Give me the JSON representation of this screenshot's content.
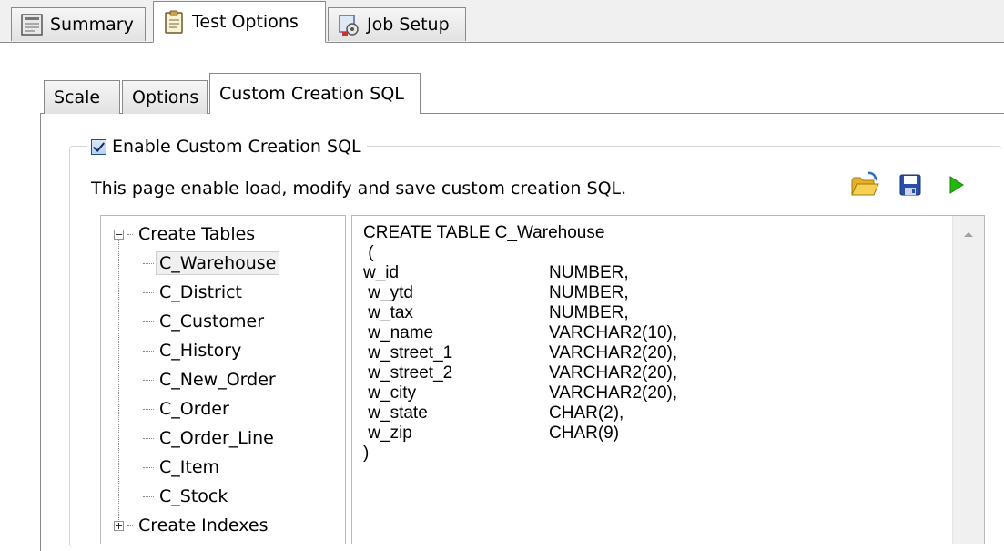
{
  "top_tabs": {
    "summary": "Summary",
    "test_options": "Test Options",
    "job_setup": "Job Setup"
  },
  "inner_tabs": {
    "scale": "Scale",
    "options": "Options",
    "custom_sql": "Custom Creation SQL"
  },
  "custom_sql": {
    "enable_label": "Enable Custom Creation SQL",
    "enabled": true,
    "description": "This page enable load, modify and save custom creation SQL.",
    "toolbar_icons": [
      "open-folder-icon",
      "save-icon",
      "run-icon"
    ]
  },
  "tree": {
    "create_tables": "Create Tables",
    "tables": [
      "C_Warehouse",
      "C_District",
      "C_Customer",
      "C_History",
      "C_New_Order",
      "C_Order",
      "C_Order_Line",
      "C_Item",
      "C_Stock"
    ],
    "selected": "C_Warehouse",
    "create_indexes": "Create Indexes"
  },
  "sql": {
    "header": "CREATE TABLE C_Warehouse",
    "open_paren": " (",
    "columns": [
      {
        "name": "w_id",
        "type": "NUMBER,"
      },
      {
        "name": " w_ytd",
        "type": "NUMBER,"
      },
      {
        "name": " w_tax",
        "type": "NUMBER,"
      },
      {
        "name": " w_name",
        "type": "VARCHAR2(10),"
      },
      {
        "name": " w_street_1",
        "type": "VARCHAR2(20),"
      },
      {
        "name": " w_street_2",
        "type": "VARCHAR2(20),"
      },
      {
        "name": " w_city",
        "type": "VARCHAR2(20),"
      },
      {
        "name": " w_state",
        "type": "CHAR(2),"
      },
      {
        "name": " w_zip",
        "type": "CHAR(9)"
      }
    ],
    "close_paren": ")"
  },
  "colors": {
    "run_green": "#22b80e",
    "save_blue": "#2a4fa8",
    "folder_yellow": "#f2c134"
  }
}
